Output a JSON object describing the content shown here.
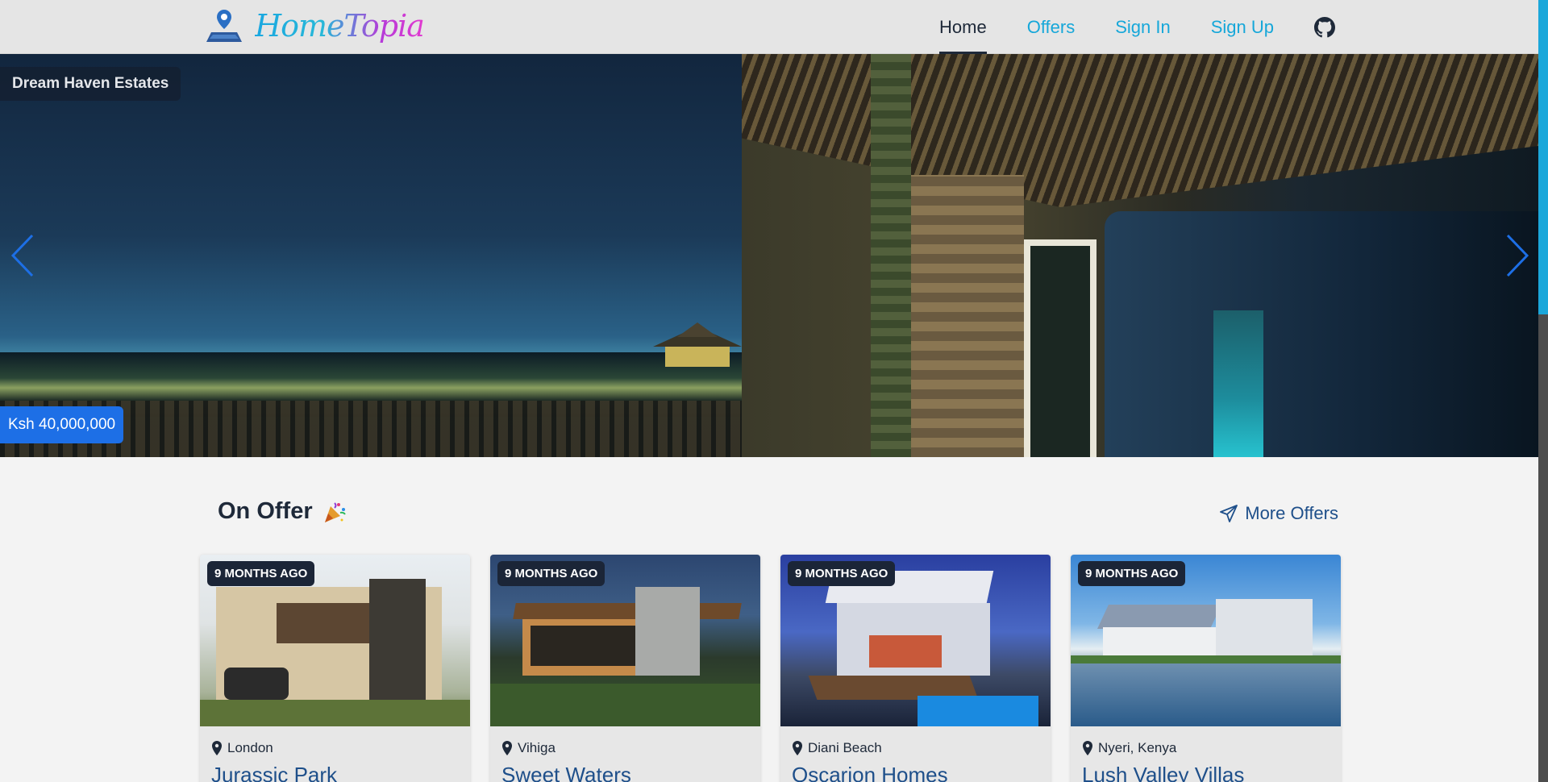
{
  "brand": {
    "name": "HomeTopia"
  },
  "nav": {
    "items": [
      {
        "label": "Home",
        "active": true
      },
      {
        "label": "Offers",
        "active": false
      },
      {
        "label": "Sign In",
        "active": false
      },
      {
        "label": "Sign Up",
        "active": false
      }
    ],
    "github_icon": "github-icon"
  },
  "hero": {
    "title": "Dream Haven Estates",
    "price": "Ksh 40,000,000"
  },
  "offers": {
    "title": "On Offer",
    "title_icon": "party-popper-icon",
    "more_label": "More Offers",
    "more_icon": "send-icon",
    "cards": [
      {
        "badge": "9 MONTHS AGO",
        "location": "London",
        "name": "Jurassic Park"
      },
      {
        "badge": "9 MONTHS AGO",
        "location": "Vihiga",
        "name": "Sweet Waters"
      },
      {
        "badge": "9 MONTHS AGO",
        "location": "Diani Beach",
        "name": "Oscarion Homes"
      },
      {
        "badge": "9 MONTHS AGO",
        "location": "Nyeri, Kenya",
        "name": "Lush Valley Villas"
      }
    ]
  },
  "colors": {
    "accent": "#16a7d9",
    "price_badge": "#1d6fe6",
    "heading": "#1e2939",
    "link": "#1e4f8a"
  }
}
